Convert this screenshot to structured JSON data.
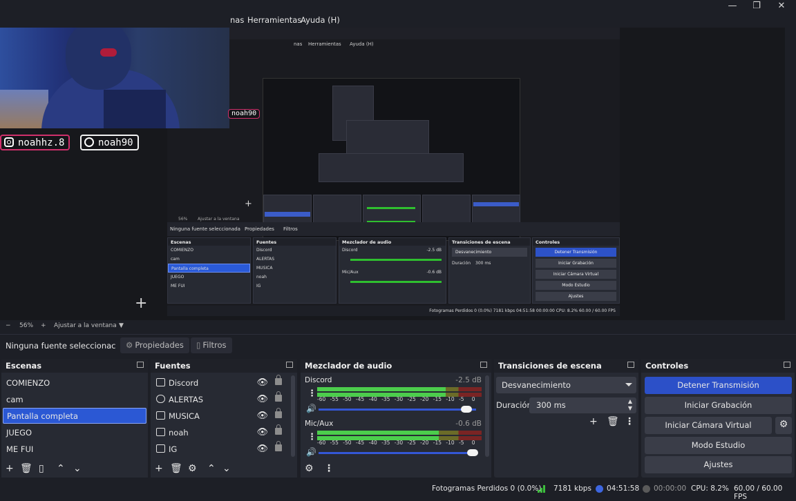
{
  "menu": {
    "items": [
      "nas",
      "Herramientas",
      "Ayuda (H)"
    ],
    "window_controls": [
      "minimize-icon",
      "maximize-icon",
      "close-icon"
    ]
  },
  "overlay": {
    "instagram_handle": "noahhz.8",
    "discord_handle": "noah90",
    "nested_handle": "noah90"
  },
  "nested_preview": {
    "menu": [
      "nas",
      "Herramientas",
      "Ayuda (H)"
    ],
    "toolbar": [
      "56%",
      "Ajustar a la ventana"
    ],
    "source_none": "Ninguna fuente seleccionada",
    "source_props": "Propiedades",
    "source_filters": "Filtros",
    "scenes_title": "Escenas",
    "scenes": [
      "COMIENZO",
      "cam",
      "Pantalla completa",
      "JUEGO",
      "ME FUI"
    ],
    "sources_title": "Fuentes",
    "sources": [
      "Discord",
      "ALERTAS",
      "MUSICA",
      "noah",
      "IG"
    ],
    "mixer_title": "Mezclador de audio",
    "mixer": [
      "Discord",
      "-2.5 dB",
      "Mic/Aux",
      "-0.6 dB"
    ],
    "transitions_title": "Transiciones de escena",
    "transition": "Desvanecimiento",
    "duration_label": "Duración",
    "duration_value": "300 ms",
    "controls_title": "Controles",
    "controls": [
      "Detener Transmisión",
      "Iniciar Grabación",
      "Iniciar Cámara Virtual",
      "Modo Estudio",
      "Ajustes"
    ],
    "status": "Fotogramas Perdidos 0 (0.0%)   7181 kbps   04:51:58   00:00:00   CPU: 8.2%   60.00 / 60.00 FPS"
  },
  "zoom": {
    "minus": "−",
    "value": "56%",
    "plus": "+",
    "fit": "Ajustar a la ventana"
  },
  "sourcebar": {
    "none_selected": "Ninguna fuente seleccionac",
    "properties": "Propiedades",
    "filters": "Filtros"
  },
  "scenes": {
    "title": "Escenas",
    "items": [
      "COMIENZO",
      "cam",
      "Pantalla completa",
      "JUEGO",
      "ME FUI"
    ],
    "selected_index": 2
  },
  "sources": {
    "title": "Fuentes",
    "items": [
      {
        "label": "Discord",
        "icon": "window-capture-icon"
      },
      {
        "label": "ALERTAS",
        "icon": "browser-source-icon"
      },
      {
        "label": "MUSICA",
        "icon": "window-capture-icon"
      },
      {
        "label": "noah",
        "icon": "image-icon"
      },
      {
        "label": "IG",
        "icon": "image-icon"
      }
    ]
  },
  "mixer": {
    "title": "Mezclador de audio",
    "channels": [
      {
        "name": "Discord",
        "db": "-2.5 dB",
        "level": 0.78,
        "volume": 0.94
      },
      {
        "name": "Mic/Aux",
        "db": "-0.6 dB",
        "level": 0.74,
        "volume": 0.98
      }
    ],
    "ticks": [
      "-60",
      "-55",
      "-50",
      "-45",
      "-40",
      "-35",
      "-30",
      "-25",
      "-20",
      "-15",
      "-10",
      "-5",
      "0"
    ]
  },
  "transitions": {
    "title": "Transiciones de escena",
    "selected": "Desvanecimiento",
    "duration_label": "Duración",
    "duration_value": "300 ms"
  },
  "controls": {
    "title": "Controles",
    "stop_stream": "Detener Transmisión",
    "start_recording": "Iniciar Grabación",
    "start_virtualcam": "Iniciar Cámara Virtual",
    "studio_mode": "Modo Estudio",
    "settings": "Ajustes"
  },
  "status": {
    "dropped_frames": "Fotogramas Perdidos 0 (0.0%)",
    "bitrate": "7181 kbps",
    "stream_time": "04:51:58",
    "record_time": "00:00:00",
    "cpu": "CPU: 8.2%",
    "fps": "60.00 / 60.00 FPS"
  },
  "colors": {
    "accent": "#2c50c8",
    "selected": "#2b58d4",
    "meter_green": "#4ccd4c",
    "instagram": "#d0306c"
  }
}
